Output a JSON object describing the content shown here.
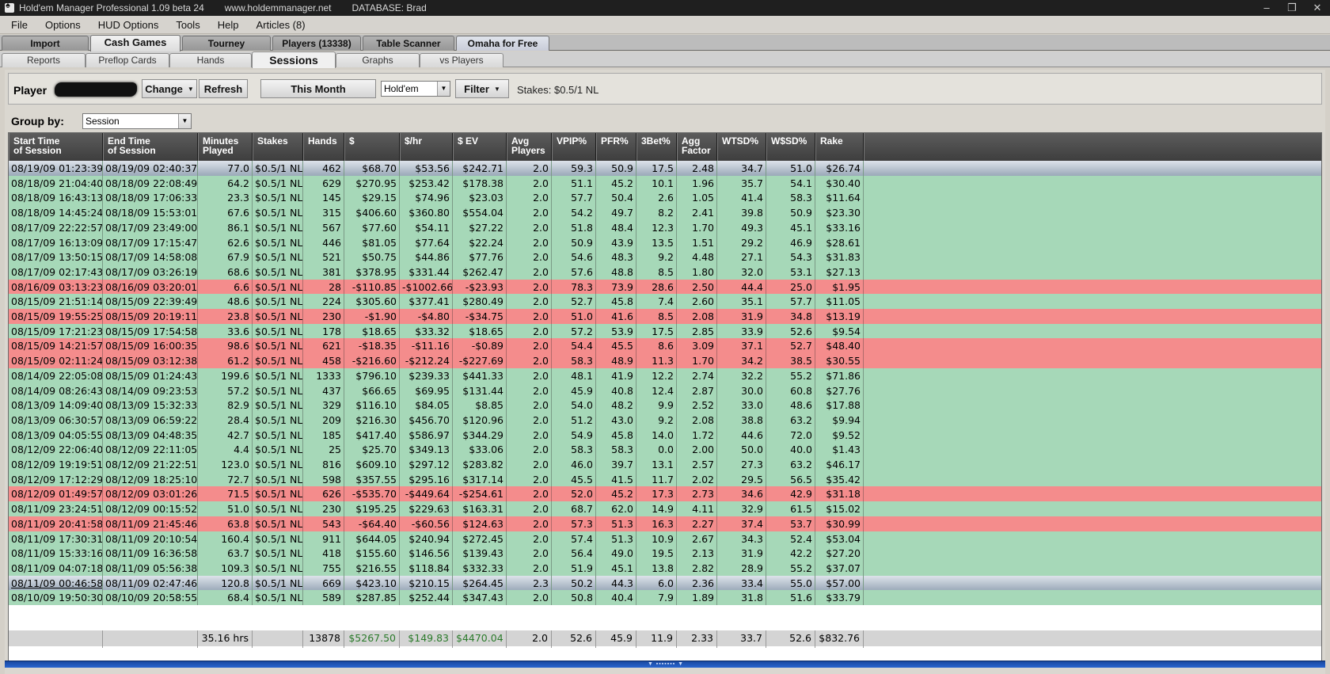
{
  "titlebar": {
    "title": "Hold'em Manager Professional 1.09 beta 24",
    "url": "www.holdemmanager.net",
    "database": "DATABASE: Brad",
    "minimize": "–",
    "restore": "❐",
    "close": "✕"
  },
  "menu": [
    "File",
    "Options",
    "HUD Options",
    "Tools",
    "Help",
    "Articles (8)"
  ],
  "main_tabs": [
    {
      "label": "Import"
    },
    {
      "label": "Cash Games"
    },
    {
      "label": "Tourney"
    },
    {
      "label": "Players (13338)"
    },
    {
      "label": "Table Scanner"
    },
    {
      "label": "Omaha for Free"
    }
  ],
  "sub_tabs": [
    {
      "label": "Reports"
    },
    {
      "label": "Preflop Cards"
    },
    {
      "label": "Hands"
    },
    {
      "label": "Sessions"
    },
    {
      "label": "Graphs"
    },
    {
      "label": "vs Players"
    }
  ],
  "player_bar": {
    "player_label": "Player",
    "change_label": "Change",
    "refresh_label": "Refresh",
    "date_range_label": "This Month",
    "game_type_value": "Hold'em",
    "filter_label": "Filter",
    "stakes_text": "Stakes: $0.5/1 NL"
  },
  "group_by": {
    "label": "Group by:",
    "value": "Session"
  },
  "table": {
    "headers": [
      [
        "Start Time",
        "of Session"
      ],
      [
        "End Time",
        "of Session"
      ],
      [
        "Minutes",
        "Played"
      ],
      [
        "Stakes"
      ],
      [
        "Hands"
      ],
      [
        "$"
      ],
      [
        "$/hr"
      ],
      [
        "$ EV"
      ],
      [
        "Avg",
        "Players"
      ],
      [
        "VPIP%"
      ],
      [
        "PFR%"
      ],
      [
        "3Bet%"
      ],
      [
        "Agg",
        "Factor"
      ],
      [
        "WTSD%"
      ],
      [
        "W$SD%"
      ],
      [
        "Rake"
      ]
    ],
    "rows": [
      {
        "status": "sel",
        "cells": [
          "08/19/09 01:23:39",
          "08/19/09 02:40:37",
          "77.0",
          "$0.5/1 NL",
          "462",
          "$68.70",
          "$53.56",
          "$242.71",
          "2.0",
          "59.3",
          "50.9",
          "17.5",
          "2.48",
          "34.7",
          "51.0",
          "$26.74"
        ]
      },
      {
        "status": "win",
        "cells": [
          "08/18/09 21:04:40",
          "08/18/09 22:08:49",
          "64.2",
          "$0.5/1 NL",
          "629",
          "$270.95",
          "$253.42",
          "$178.38",
          "2.0",
          "51.1",
          "45.2",
          "10.1",
          "1.96",
          "35.7",
          "54.1",
          "$30.40"
        ]
      },
      {
        "status": "win",
        "cells": [
          "08/18/09 16:43:13",
          "08/18/09 17:06:33",
          "23.3",
          "$0.5/1 NL",
          "145",
          "$29.15",
          "$74.96",
          "$23.03",
          "2.0",
          "57.7",
          "50.4",
          "2.6",
          "1.05",
          "41.4",
          "58.3",
          "$11.64"
        ]
      },
      {
        "status": "win",
        "cells": [
          "08/18/09 14:45:24",
          "08/18/09 15:53:01",
          "67.6",
          "$0.5/1 NL",
          "315",
          "$406.60",
          "$360.80",
          "$554.04",
          "2.0",
          "54.2",
          "49.7",
          "8.2",
          "2.41",
          "39.8",
          "50.9",
          "$23.30"
        ]
      },
      {
        "status": "win",
        "cells": [
          "08/17/09 22:22:57",
          "08/17/09 23:49:00",
          "86.1",
          "$0.5/1 NL",
          "567",
          "$77.60",
          "$54.11",
          "$27.22",
          "2.0",
          "51.8",
          "48.4",
          "12.3",
          "1.70",
          "49.3",
          "45.1",
          "$33.16"
        ]
      },
      {
        "status": "win",
        "cells": [
          "08/17/09 16:13:09",
          "08/17/09 17:15:47",
          "62.6",
          "$0.5/1 NL",
          "446",
          "$81.05",
          "$77.64",
          "$22.24",
          "2.0",
          "50.9",
          "43.9",
          "13.5",
          "1.51",
          "29.2",
          "46.9",
          "$28.61"
        ]
      },
      {
        "status": "win",
        "cells": [
          "08/17/09 13:50:15",
          "08/17/09 14:58:08",
          "67.9",
          "$0.5/1 NL",
          "521",
          "$50.75",
          "$44.86",
          "$77.76",
          "2.0",
          "54.6",
          "48.3",
          "9.2",
          "4.48",
          "27.1",
          "54.3",
          "$31.83"
        ]
      },
      {
        "status": "win",
        "cells": [
          "08/17/09 02:17:43",
          "08/17/09 03:26:19",
          "68.6",
          "$0.5/1 NL",
          "381",
          "$378.95",
          "$331.44",
          "$262.47",
          "2.0",
          "57.6",
          "48.8",
          "8.5",
          "1.80",
          "32.0",
          "53.1",
          "$27.13"
        ]
      },
      {
        "status": "neg",
        "cells": [
          "08/16/09 03:13:23",
          "08/16/09 03:20:01",
          "6.6",
          "$0.5/1 NL",
          "28",
          "-$110.85",
          "-$1002.66",
          "-$23.93",
          "2.0",
          "78.3",
          "73.9",
          "28.6",
          "2.50",
          "44.4",
          "25.0",
          "$1.95"
        ]
      },
      {
        "status": "win",
        "cells": [
          "08/15/09 21:51:14",
          "08/15/09 22:39:49",
          "48.6",
          "$0.5/1 NL",
          "224",
          "$305.60",
          "$377.41",
          "$280.49",
          "2.0",
          "52.7",
          "45.8",
          "7.4",
          "2.60",
          "35.1",
          "57.7",
          "$11.05"
        ]
      },
      {
        "status": "neg",
        "cells": [
          "08/15/09 19:55:25",
          "08/15/09 20:19:11",
          "23.8",
          "$0.5/1 NL",
          "230",
          "-$1.90",
          "-$4.80",
          "-$34.75",
          "2.0",
          "51.0",
          "41.6",
          "8.5",
          "2.08",
          "31.9",
          "34.8",
          "$13.19"
        ]
      },
      {
        "status": "win",
        "cells": [
          "08/15/09 17:21:23",
          "08/15/09 17:54:58",
          "33.6",
          "$0.5/1 NL",
          "178",
          "$18.65",
          "$33.32",
          "$18.65",
          "2.0",
          "57.2",
          "53.9",
          "17.5",
          "2.85",
          "33.9",
          "52.6",
          "$9.54"
        ]
      },
      {
        "status": "neg",
        "cells": [
          "08/15/09 14:21:57",
          "08/15/09 16:00:35",
          "98.6",
          "$0.5/1 NL",
          "621",
          "-$18.35",
          "-$11.16",
          "-$0.89",
          "2.0",
          "54.4",
          "45.5",
          "8.6",
          "3.09",
          "37.1",
          "52.7",
          "$48.40"
        ]
      },
      {
        "status": "neg",
        "cells": [
          "08/15/09 02:11:24",
          "08/15/09 03:12:38",
          "61.2",
          "$0.5/1 NL",
          "458",
          "-$216.60",
          "-$212.24",
          "-$227.69",
          "2.0",
          "58.3",
          "48.9",
          "11.3",
          "1.70",
          "34.2",
          "38.5",
          "$30.55"
        ]
      },
      {
        "status": "win",
        "cells": [
          "08/14/09 22:05:08",
          "08/15/09 01:24:43",
          "199.6",
          "$0.5/1 NL",
          "1333",
          "$796.10",
          "$239.33",
          "$441.33",
          "2.0",
          "48.1",
          "41.9",
          "12.2",
          "2.74",
          "32.2",
          "55.2",
          "$71.86"
        ]
      },
      {
        "status": "win",
        "cells": [
          "08/14/09 08:26:43",
          "08/14/09 09:23:53",
          "57.2",
          "$0.5/1 NL",
          "437",
          "$66.65",
          "$69.95",
          "$131.44",
          "2.0",
          "45.9",
          "40.8",
          "12.4",
          "2.87",
          "30.0",
          "60.8",
          "$27.76"
        ]
      },
      {
        "status": "win",
        "cells": [
          "08/13/09 14:09:40",
          "08/13/09 15:32:33",
          "82.9",
          "$0.5/1 NL",
          "329",
          "$116.10",
          "$84.05",
          "$8.85",
          "2.0",
          "54.0",
          "48.2",
          "9.9",
          "2.52",
          "33.0",
          "48.6",
          "$17.88"
        ]
      },
      {
        "status": "win",
        "cells": [
          "08/13/09 06:30:57",
          "08/13/09 06:59:22",
          "28.4",
          "$0.5/1 NL",
          "209",
          "$216.30",
          "$456.70",
          "$120.96",
          "2.0",
          "51.2",
          "43.0",
          "9.2",
          "2.08",
          "38.8",
          "63.2",
          "$9.94"
        ]
      },
      {
        "status": "win",
        "cells": [
          "08/13/09 04:05:55",
          "08/13/09 04:48:35",
          "42.7",
          "$0.5/1 NL",
          "185",
          "$417.40",
          "$586.97",
          "$344.29",
          "2.0",
          "54.9",
          "45.8",
          "14.0",
          "1.72",
          "44.6",
          "72.0",
          "$9.52"
        ]
      },
      {
        "status": "win",
        "cells": [
          "08/12/09 22:06:40",
          "08/12/09 22:11:05",
          "4.4",
          "$0.5/1 NL",
          "25",
          "$25.70",
          "$349.13",
          "$33.06",
          "2.0",
          "58.3",
          "58.3",
          "0.0",
          "2.00",
          "50.0",
          "40.0",
          "$1.43"
        ]
      },
      {
        "status": "win",
        "cells": [
          "08/12/09 19:19:51",
          "08/12/09 21:22:51",
          "123.0",
          "$0.5/1 NL",
          "816",
          "$609.10",
          "$297.12",
          "$283.82",
          "2.0",
          "46.0",
          "39.7",
          "13.1",
          "2.57",
          "27.3",
          "63.2",
          "$46.17"
        ]
      },
      {
        "status": "win",
        "cells": [
          "08/12/09 17:12:29",
          "08/12/09 18:25:10",
          "72.7",
          "$0.5/1 NL",
          "598",
          "$357.55",
          "$295.16",
          "$317.14",
          "2.0",
          "45.5",
          "41.5",
          "11.7",
          "2.02",
          "29.5",
          "56.5",
          "$35.42"
        ]
      },
      {
        "status": "neg",
        "cells": [
          "08/12/09 01:49:57",
          "08/12/09 03:01:26",
          "71.5",
          "$0.5/1 NL",
          "626",
          "-$535.70",
          "-$449.64",
          "-$254.61",
          "2.0",
          "52.0",
          "45.2",
          "17.3",
          "2.73",
          "34.6",
          "42.9",
          "$31.18"
        ]
      },
      {
        "status": "win",
        "cells": [
          "08/11/09 23:24:51",
          "08/12/09 00:15:52",
          "51.0",
          "$0.5/1 NL",
          "230",
          "$195.25",
          "$229.63",
          "$163.31",
          "2.0",
          "68.7",
          "62.0",
          "14.9",
          "4.11",
          "32.9",
          "61.5",
          "$15.02"
        ]
      },
      {
        "status": "neg",
        "cells": [
          "08/11/09 20:41:58",
          "08/11/09 21:45:46",
          "63.8",
          "$0.5/1 NL",
          "543",
          "-$64.40",
          "-$60.56",
          "$124.63",
          "2.0",
          "57.3",
          "51.3",
          "16.3",
          "2.27",
          "37.4",
          "53.7",
          "$30.99"
        ]
      },
      {
        "status": "win",
        "cells": [
          "08/11/09 17:30:31",
          "08/11/09 20:10:54",
          "160.4",
          "$0.5/1 NL",
          "911",
          "$644.05",
          "$240.94",
          "$272.45",
          "2.0",
          "57.4",
          "51.3",
          "10.9",
          "2.67",
          "34.3",
          "52.4",
          "$53.04"
        ]
      },
      {
        "status": "win",
        "cells": [
          "08/11/09 15:33:16",
          "08/11/09 16:36:58",
          "63.7",
          "$0.5/1 NL",
          "418",
          "$155.60",
          "$146.56",
          "$139.43",
          "2.0",
          "56.4",
          "49.0",
          "19.5",
          "2.13",
          "31.9",
          "42.2",
          "$27.20"
        ]
      },
      {
        "status": "win",
        "cells": [
          "08/11/09 04:07:18",
          "08/11/09 05:56:38",
          "109.3",
          "$0.5/1 NL",
          "755",
          "$216.55",
          "$118.84",
          "$332.33",
          "2.0",
          "51.9",
          "45.1",
          "13.8",
          "2.82",
          "28.9",
          "55.2",
          "$37.07"
        ]
      },
      {
        "status": "sel",
        "cells": [
          "08/11/09 00:46:58",
          "08/11/09 02:47:46",
          "120.8",
          "$0.5/1 NL",
          "669",
          "$423.10",
          "$210.15",
          "$264.45",
          "2.3",
          "50.2",
          "44.3",
          "6.0",
          "2.36",
          "33.4",
          "55.0",
          "$57.00"
        ]
      },
      {
        "status": "win",
        "cells": [
          "08/10/09 19:50:30",
          "08/10/09 20:58:55",
          "68.4",
          "$0.5/1 NL",
          "589",
          "$287.85",
          "$252.44",
          "$347.43",
          "2.0",
          "50.8",
          "40.4",
          "7.9",
          "1.89",
          "31.8",
          "51.6",
          "$33.79"
        ]
      }
    ],
    "totals": [
      "",
      "",
      "35.16 hrs",
      "",
      "13878",
      "$5267.50",
      "$149.83",
      "$4470.04",
      "2.0",
      "52.6",
      "45.9",
      "11.9",
      "2.33",
      "33.7",
      "52.6",
      "$832.76"
    ]
  },
  "colors": {
    "winning_row": "#a6d8b8",
    "losing_row": "#f48c8c",
    "header": "#4a4a4a",
    "splitter": "#2a66d0"
  }
}
